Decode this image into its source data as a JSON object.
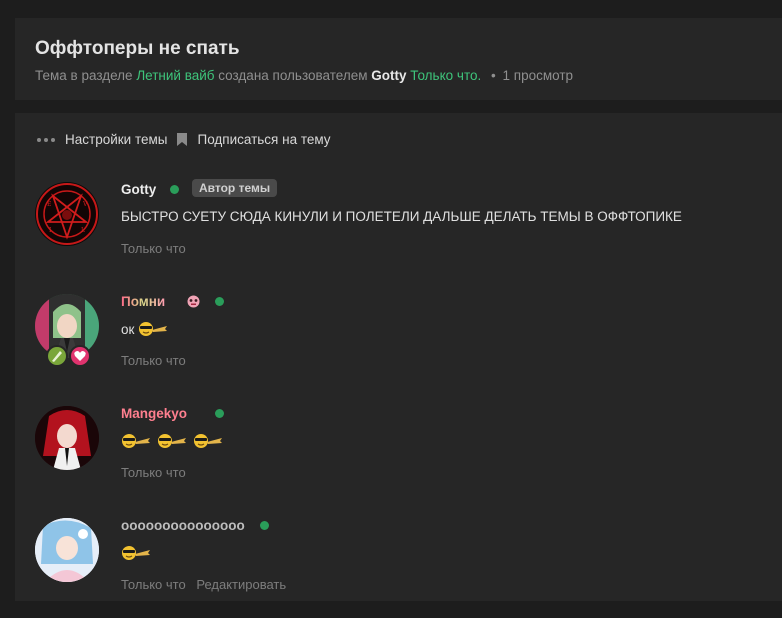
{
  "thread": {
    "title": "Оффтоперы не спать",
    "meta_prefix": "Тема в разделе",
    "section": "Летний вайб",
    "meta_created_by": "создана пользователем",
    "author": "Gotty",
    "created_time": "Только что.",
    "meta_dot": "•",
    "views": "1 просмотр"
  },
  "toolbar": {
    "settings_label": "Настройки темы",
    "subscribe_label": "Подписаться на тему"
  },
  "posts": [
    {
      "username": "Gotty",
      "badge": "Автор темы",
      "text": "БЫСТРО СУЕТУ СЮДА КИНУЛИ И ПОЛЕТЕЛИ ДАЛЬШЕ ДЕЛАТЬ ТЕМЫ В ОФФТОПИКЕ",
      "time": "Только что"
    },
    {
      "username": "Помни",
      "text": "ок",
      "time": "Только что"
    },
    {
      "username": "Mangekyo",
      "text": "",
      "time": "Только что"
    },
    {
      "username": "ooooooooooooooo",
      "text": "",
      "time": "Только что",
      "edit": "Редактировать"
    }
  ],
  "colors": {
    "accent_green": "#3ec47b",
    "online": "#2a9d5a",
    "pink_name": "#ff7f8f"
  }
}
